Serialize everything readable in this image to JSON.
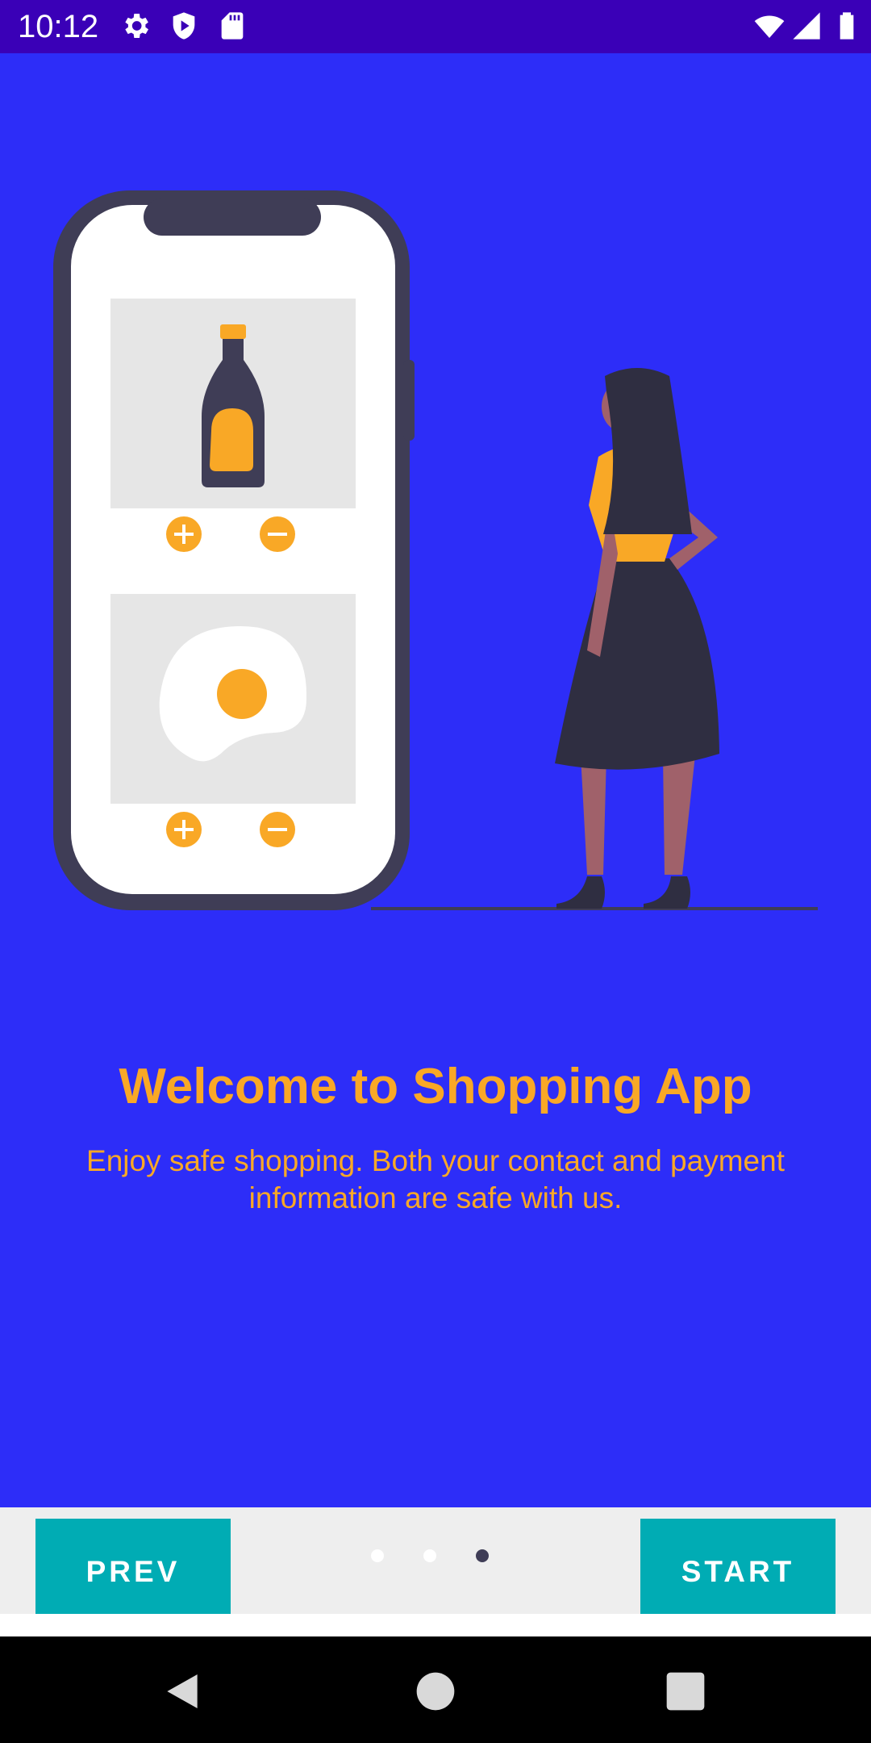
{
  "status_bar": {
    "time": "10:12",
    "left_icons": [
      "settings-icon",
      "shield-icon",
      "sd-card-icon"
    ],
    "right_icons": [
      "wifi-icon",
      "signal-icon",
      "battery-icon"
    ],
    "background": "#3a00b7"
  },
  "onboarding": {
    "title": "Welcome to Shopping App",
    "description": "Enjoy safe shopping. Both your contact and payment information are safe with us.",
    "background": "#2d2df8",
    "accent": "#f9a826"
  },
  "pager": {
    "prev_label": "PREV",
    "start_label": "START",
    "page_count": 3,
    "current_page": 3,
    "button_color": "#00acb4"
  },
  "nav_bar": {
    "buttons": [
      "back-icon",
      "home-icon",
      "recents-icon"
    ]
  }
}
